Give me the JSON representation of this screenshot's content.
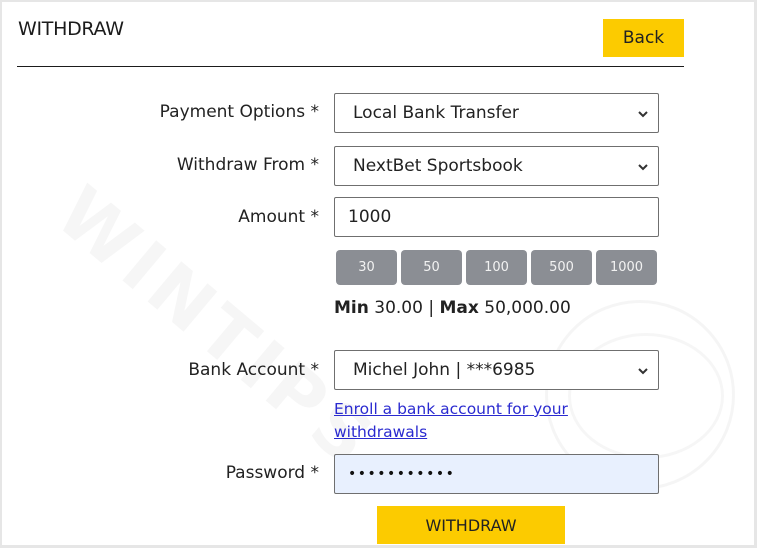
{
  "header": {
    "title": "WITHDRAW",
    "back_label": "Back"
  },
  "form": {
    "payment_options": {
      "label": "Payment Options *",
      "value": "Local Bank Transfer"
    },
    "withdraw_from": {
      "label": "Withdraw From *",
      "value": "NextBet Sportsbook"
    },
    "amount": {
      "label": "Amount *",
      "value": "1000"
    },
    "quick_amounts": [
      "30",
      "50",
      "100",
      "500",
      "1000"
    ],
    "limits": {
      "min_label": "Min",
      "min_value": "30.00",
      "separator": "|",
      "max_label": "Max",
      "max_value": "50,000.00"
    },
    "bank_account": {
      "label": "Bank Account *",
      "value": "Michel John | ***6985"
    },
    "enroll_link": "Enroll a bank account for your withdrawals",
    "password": {
      "label": "Password *",
      "masked_value": "•••••••••••"
    },
    "submit_label": "WITHDRAW"
  },
  "watermark": "WINTIPS",
  "colors": {
    "accent_yellow": "#fccb00",
    "quick_button_gray": "#8b8e94",
    "password_autofill_bg": "#e8f0fe",
    "link_blue": "#2a2ad0"
  }
}
